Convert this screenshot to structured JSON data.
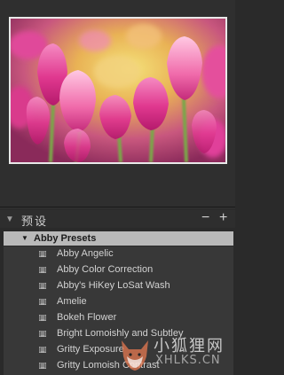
{
  "presets_panel": {
    "title": "预设",
    "minus_label": "−",
    "plus_label": "+"
  },
  "folder": {
    "label": "Abby Presets"
  },
  "presets": [
    "Abby Angelic",
    "Abby Color Correction",
    "Abby's HiKey LoSat Wash",
    "Amelie",
    "Bokeh Flower",
    "Bright Lomoishly and Subtley",
    "Gritty Exposure",
    "Gritty Lomoish Contrast"
  ],
  "watermark": {
    "title": "小狐狸网",
    "url": "XHLKS.CN"
  },
  "colors": {
    "panel_bg": "#2a2a2a",
    "folder_bg": "#b9b9b9",
    "list_bg": "#383838",
    "text": "#d2d2d2"
  }
}
